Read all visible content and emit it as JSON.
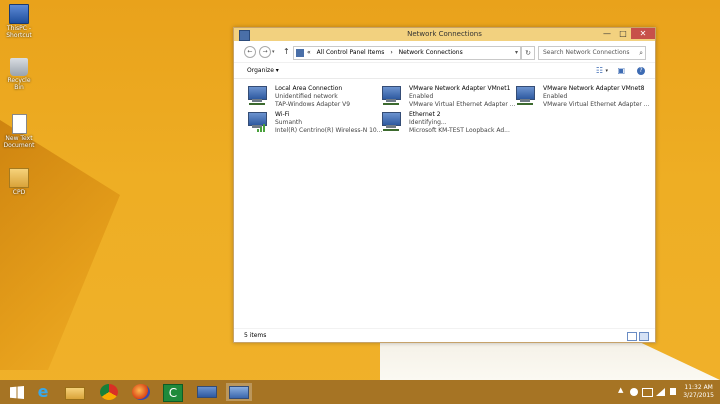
{
  "desktop": {
    "icons": [
      {
        "label": "ThisPC - Shortcut",
        "icon": "computer-icon"
      },
      {
        "label": "Recycle Bin",
        "icon": "recycle-bin-icon"
      },
      {
        "label": "New Text Document",
        "icon": "text-document-icon"
      },
      {
        "label": "CPD",
        "icon": "folder-icon"
      }
    ]
  },
  "window": {
    "title": "Network Connections",
    "controls": {
      "minimize": "—",
      "maximize": "□",
      "close": "✕"
    },
    "nav": {
      "back": "←",
      "forward": "→",
      "recent": "▾",
      "up": "↑",
      "breadcrumb": [
        "«",
        "All Control Panel Items",
        "›",
        "Network Connections"
      ],
      "address_dropdown": "▾",
      "refresh": "↻",
      "search_placeholder": "Search Network Connections",
      "search_icon": "⌕"
    },
    "command_bar": {
      "organize": "Organize ▾",
      "view_options": "☷",
      "view_dropdown": "▾",
      "preview_pane": "▣",
      "help": "?"
    },
    "items": [
      {
        "name": "Local Area Connection",
        "status": "Unidentified network",
        "device": "TAP-Windows Adapter V9",
        "type": "wired"
      },
      {
        "name": "VMware Network Adapter VMnet1",
        "status": "Enabled",
        "device": "VMware Virtual Ethernet Adapter ...",
        "type": "wired"
      },
      {
        "name": "VMware Network Adapter VMnet8",
        "status": "Enabled",
        "device": "VMware Virtual Ethernet Adapter ...",
        "type": "wired"
      },
      {
        "name": "Wi-Fi",
        "status": "Sumanth",
        "device": "Intel(R) Centrino(R) Wireless-N 10...",
        "type": "wireless"
      },
      {
        "name": "Ethernet 2",
        "status": "Identifying...",
        "device": "Microsoft KM-TEST Loopback Ad...",
        "type": "wired"
      }
    ],
    "status": {
      "count": "5 items"
    }
  },
  "taskbar": {
    "apps": [
      {
        "name": "start",
        "icon": "windows-logo-icon"
      },
      {
        "name": "internet-explorer",
        "icon": "internet-explorer-icon",
        "glyph": "e"
      },
      {
        "name": "file-explorer",
        "icon": "folder-icon"
      },
      {
        "name": "chrome",
        "icon": "chrome-icon"
      },
      {
        "name": "firefox",
        "icon": "firefox-icon"
      },
      {
        "name": "camtasia",
        "icon": "camtasia-icon",
        "glyph": "C"
      },
      {
        "name": "network-app",
        "icon": "network-icon"
      },
      {
        "name": "network-connections",
        "icon": "network-connections-icon"
      }
    ],
    "tray": {
      "chevron": "▲",
      "time": "11:32 AM",
      "date": "3/27/2015"
    }
  }
}
